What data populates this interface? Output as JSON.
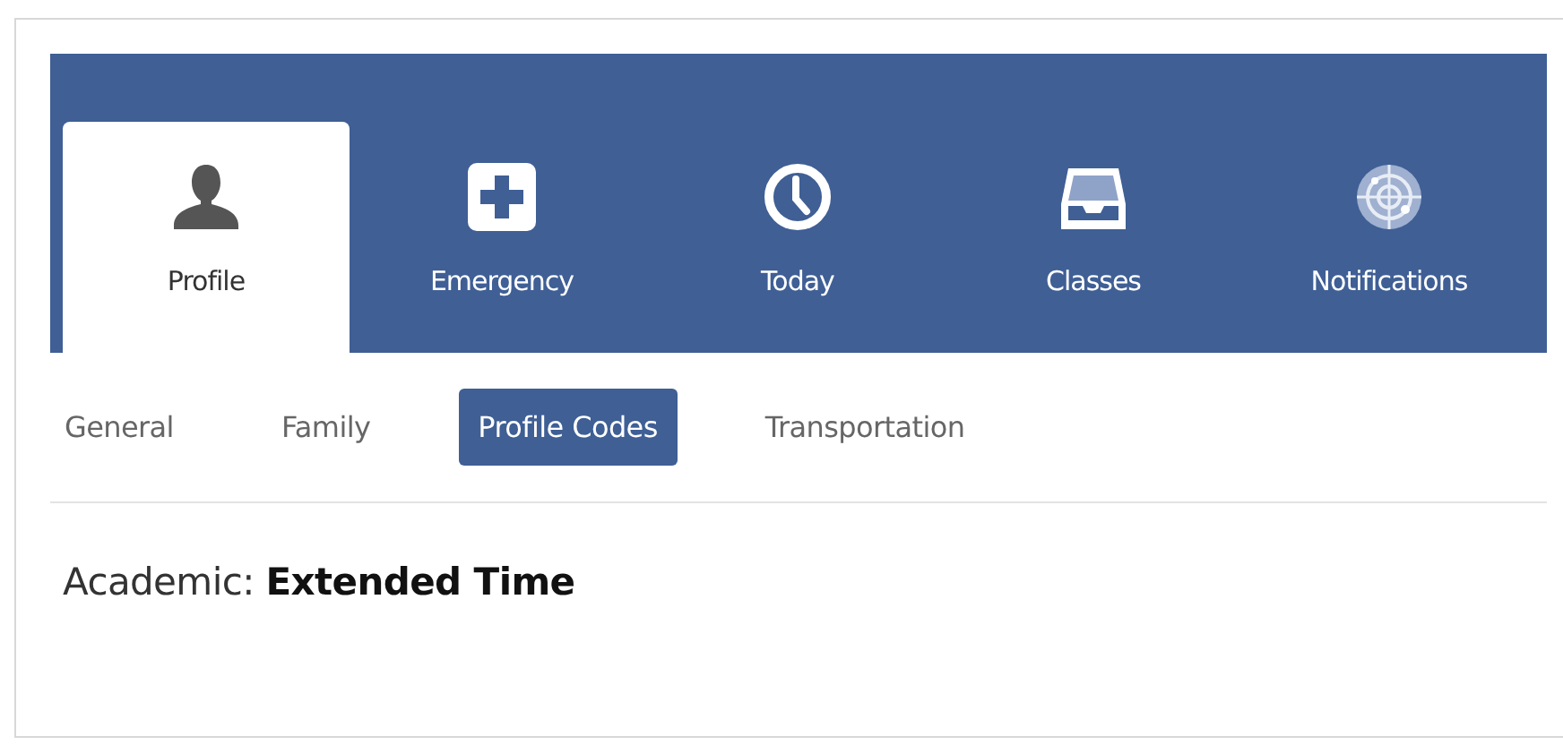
{
  "tabs": [
    {
      "label": "Profile",
      "kind": "person",
      "selected": true
    },
    {
      "label": "Emergency",
      "kind": "plus",
      "selected": false
    },
    {
      "label": "Today",
      "kind": "clock",
      "selected": false
    },
    {
      "label": "Classes",
      "kind": "tray",
      "selected": false
    },
    {
      "label": "Notifications",
      "kind": "radar",
      "selected": false
    }
  ],
  "subtabs": [
    {
      "label": "General",
      "selected": false
    },
    {
      "label": "Family",
      "selected": false
    },
    {
      "label": "Profile Codes",
      "selected": true
    },
    {
      "label": "Transportation",
      "selected": false
    }
  ],
  "content": "Academic: **Extended Time**"
}
